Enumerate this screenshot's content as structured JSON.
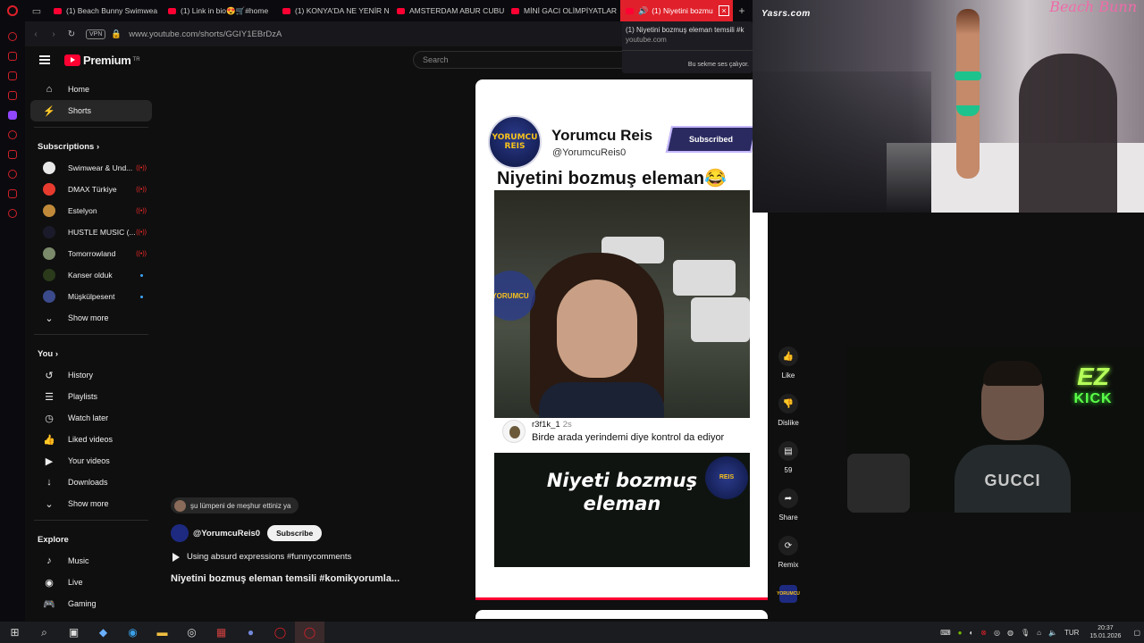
{
  "browser": {
    "tabs": [
      {
        "label": "(1) Beach Bunny Swimwea"
      },
      {
        "label": "(1) Link in bio😍🛒#home"
      },
      {
        "label": "(1) KONYA'DA NE YENİR N"
      },
      {
        "label": "AMSTERDAM ABUR CUBU"
      },
      {
        "label": "MİNİ GACI OLİMPİYATLAR"
      },
      {
        "label": "(1) Niyetini bozmu"
      }
    ],
    "new_tab_label": "+",
    "vpn_label": "VPN",
    "url": "www.youtube.com/shorts/GGIY1EBrDzA",
    "tooltip": {
      "title": "(1) Niyetini bozmuş eleman temsili #k",
      "domain": "youtube.com",
      "audio_note": "Bu sekme ses çalıyor."
    }
  },
  "youtube": {
    "brand": "Premium",
    "region": "TR",
    "search_placeholder": "Search",
    "nav": [
      {
        "label": "Home"
      },
      {
        "label": "Shorts"
      }
    ],
    "subscriptions_title": "Subscriptions",
    "subscriptions": [
      {
        "label": "Swimwear & Und...",
        "avatar_color": "#e8e8e8"
      },
      {
        "label": "DMAX Türkiye",
        "avatar_color": "#e63b2e"
      },
      {
        "label": "Estelyon",
        "avatar_color": "#c08a3a"
      },
      {
        "label": "HUSTLE MUSIC (...",
        "avatar_color": "#1a1a2a"
      },
      {
        "label": "Tomorrowland",
        "avatar_color": "#7a8a6a"
      },
      {
        "label": "Kanser olduk",
        "avatar_color": "#2a3a1a"
      },
      {
        "label": "Müşkülpesent",
        "avatar_color": "#3a4a8a"
      }
    ],
    "show_more_1": "Show more",
    "you_title": "You",
    "you_items": [
      {
        "label": "History"
      },
      {
        "label": "Playlists"
      },
      {
        "label": "Watch later"
      },
      {
        "label": "Liked videos"
      },
      {
        "label": "Your videos"
      },
      {
        "label": "Downloads"
      }
    ],
    "show_more_2": "Show more",
    "explore_title": "Explore",
    "explore_items": [
      {
        "label": "Music"
      },
      {
        "label": "Live"
      },
      {
        "label": "Gaming"
      }
    ]
  },
  "short": {
    "channel_logo_text_1": "YORUMCU",
    "channel_logo_text_2": "REIS",
    "channel_name": "Yorumcu Reis",
    "channel_handle": "@YorumcuReis0",
    "subscribed_badge": "Subscribed",
    "title_overlay": "Niyetini bozmuş eleman😂",
    "comment_user": "r3f1k_1",
    "comment_age": "2s",
    "comment_text": "Birde arada yerindemi diye kontrol da ediyor",
    "bottom_caption_1": "Niyeti bozmuş",
    "bottom_caption_2": "eleman"
  },
  "actions": {
    "like": "Like",
    "dislike": "Dislike",
    "comments": "59",
    "share": "Share",
    "remix": "Remix"
  },
  "meta": {
    "suggestion": "şu lümpeni de meşhur ettiniz ya",
    "channel": "@YorumcuReis0",
    "subscribe": "Subscribe",
    "sound": "Using absurd expressions #funnycomments",
    "title": "Niyetini bozmuş eleman temsili #komikyorumla..."
  },
  "overlays": {
    "fashion_logo": "Yasrs.com",
    "fashion_brand": "Beach Bunn",
    "neon_top": "EZ",
    "neon_bottom": "KICK",
    "shirt_text": "GUCCI"
  },
  "taskbar": {
    "language": "TUR",
    "time": "20:37",
    "date": "15.01.2026"
  }
}
